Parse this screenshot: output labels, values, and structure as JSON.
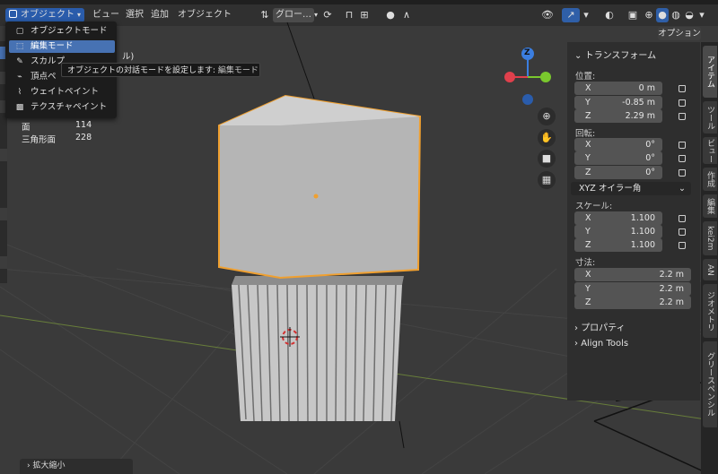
{
  "header": {
    "mode_label": "オブジェクト",
    "view_menu": "ビュー",
    "select_menu": "選択",
    "add_menu": "追加",
    "object_menu": "オブジェクト",
    "transform_orientation": "グロー…",
    "options_label": "オプション"
  },
  "mode_menu": {
    "items": [
      {
        "label": "オブジェクトモード",
        "icon": "object-mode-icon"
      },
      {
        "label": "編集モード",
        "icon": "edit-mode-icon",
        "selected": true
      },
      {
        "label": "スカルプ",
        "icon": "sculpt-mode-icon"
      },
      {
        "label": "頂点ペ",
        "icon": "vertex-paint-icon"
      },
      {
        "label": "ウェイトペイント",
        "icon": "weight-paint-icon"
      },
      {
        "label": "テクスチャペイント",
        "icon": "texture-paint-icon"
      }
    ],
    "partial_text": "ル)"
  },
  "tooltip": {
    "text": "オブジェクトの対話モードを設定します:",
    "mode": "編集モード"
  },
  "stats": [
    {
      "label": "面",
      "value": "114"
    },
    {
      "label": "三角形面",
      "value": "228"
    }
  ],
  "sidebar": {
    "transform_title": "トランスフォーム",
    "location_label": "位置:",
    "location": [
      {
        "axis": "X",
        "value": "0 m"
      },
      {
        "axis": "Y",
        "value": "-0.85 m"
      },
      {
        "axis": "Z",
        "value": "2.29 m"
      }
    ],
    "rotation_label": "回転:",
    "rotation": [
      {
        "axis": "X",
        "value": "0°"
      },
      {
        "axis": "Y",
        "value": "0°"
      },
      {
        "axis": "Z",
        "value": "0°"
      }
    ],
    "rotation_mode": "XYZ オイラー角",
    "scale_label": "スケール:",
    "scale": [
      {
        "axis": "X",
        "value": "1.100"
      },
      {
        "axis": "Y",
        "value": "1.100"
      },
      {
        "axis": "Z",
        "value": "1.100"
      }
    ],
    "dimensions_label": "寸法:",
    "dimensions": [
      {
        "axis": "X",
        "value": "2.2 m"
      },
      {
        "axis": "Y",
        "value": "2.2 m"
      },
      {
        "axis": "Z",
        "value": "2.2 m"
      }
    ],
    "properties_label": "プロパティ",
    "align_tools_label": "Align Tools"
  },
  "tabs": [
    "アイテム",
    "ツール",
    "ビュー",
    "作成",
    "編集",
    "kei2m",
    "AN",
    "ジオメトリ",
    "グリースペンシル"
  ],
  "gizmo": {
    "z_label": "Z",
    "x_color": "#e0404c",
    "y_color": "#7ac82d",
    "z_color": "#3b7ee0"
  },
  "status": {
    "last_op": "拡大縮小"
  },
  "colors": {
    "accent": "#2f5fa8",
    "selection_outline": "#f0a030",
    "menu_highlight": "#4772b3"
  }
}
